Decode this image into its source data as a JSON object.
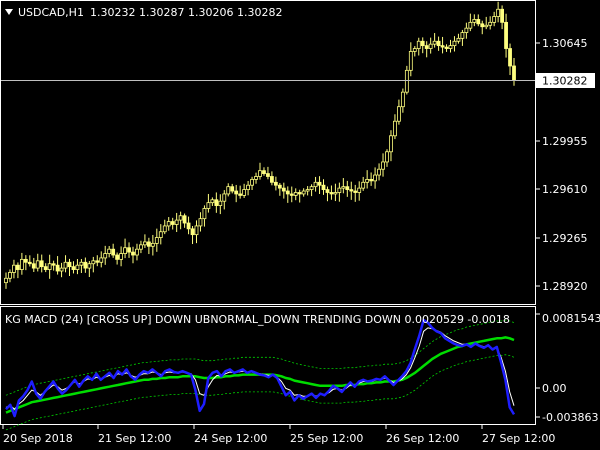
{
  "main_panel": {
    "symbol_label": "USDCAD,H1",
    "ohlc": "1.30232 1.30287 1.30206 1.30282",
    "current_price": "1.30282",
    "price_ticks": [
      "1.30645",
      "1.29955",
      "1.29610",
      "1.29265",
      "1.28920"
    ]
  },
  "indicator_panel": {
    "header": "KG MACD (24)  [CROSS UP]  DOWN  UBNORMAL_DOWN  TRENDING DOWN 0.0020529 -0.0018",
    "ticks": [
      "0.0081543",
      "0.00",
      "-0.003863"
    ]
  },
  "time_axis": {
    "labels": [
      "20 Sep 2018",
      "21 Sep 12:00",
      "24 Sep 12:00",
      "25 Sep 12:00",
      "26 Sep 12:00",
      "27 Sep 12:00"
    ]
  },
  "colors": {
    "background": "#000000",
    "candle": "#ffff80",
    "grid": "#ffffff",
    "price_line": "#c0c0c0",
    "macd_fast": "#1e1eff",
    "macd_signal": "#ffffff",
    "macd_slow": "#00dd00",
    "envelope": "#00cc00"
  },
  "chart_data": [
    {
      "type": "candlestick",
      "title": "USDCAD,H1",
      "ylim": [
        1.2875,
        1.3082
      ],
      "closes": [
        1.2892,
        1.2896,
        1.2901,
        1.2898,
        1.2905,
        1.2903,
        1.2902,
        1.2899,
        1.2904,
        1.29,
        1.2898,
        1.2902,
        1.2901,
        1.2897,
        1.2899,
        1.2903,
        1.29,
        1.2898,
        1.2901,
        1.2903,
        1.2899,
        1.2902,
        1.2904,
        1.2903,
        1.2906,
        1.2909,
        1.2912,
        1.2908,
        1.2905,
        1.2909,
        1.2913,
        1.291,
        1.2908,
        1.2912,
        1.2915,
        1.2917,
        1.2914,
        1.2916,
        1.292,
        1.2924,
        1.2928,
        1.2931,
        1.2929,
        1.2932,
        1.2935,
        1.293,
        1.2926,
        1.2922,
        1.2928,
        1.2933,
        1.294,
        1.2944,
        1.2946,
        1.2942,
        1.2945,
        1.295,
        1.2955,
        1.2952,
        1.295,
        1.2949,
        1.2953,
        1.2956,
        1.296,
        1.2962,
        1.2966,
        1.2964,
        1.2962,
        1.2958,
        1.2956,
        1.2954,
        1.2952,
        1.295,
        1.2949,
        1.2951,
        1.295,
        1.2952,
        1.2953,
        1.2955,
        1.2958,
        1.2956,
        1.2953,
        1.2951,
        1.295,
        1.2951,
        1.2954,
        1.2955,
        1.2953,
        1.2952,
        1.2951,
        1.2954,
        1.2958,
        1.296,
        1.2959,
        1.2963,
        1.2967,
        1.2972,
        1.2979,
        1.299,
        1.3,
        1.301,
        1.302,
        1.3035,
        1.3048,
        1.305,
        1.3055,
        1.3052,
        1.305,
        1.3053,
        1.3055,
        1.3052,
        1.3051,
        1.305,
        1.3052,
        1.3055,
        1.3057,
        1.3061,
        1.3064,
        1.3068,
        1.307,
        1.3067,
        1.3065,
        1.3066,
        1.3068,
        1.3072,
        1.3077,
        1.3068,
        1.305,
        1.3038,
        1.3028
      ]
    },
    {
      "type": "line",
      "title": "KG MACD (24)",
      "ylim": [
        -0.0046,
        0.0087
      ],
      "series": [
        {
          "name": "",
          "color": "#1e1eff",
          "values": [
            -0.003,
            -0.0025,
            -0.0038,
            -0.002,
            -0.0015,
            -0.0008,
            0.0002,
            -0.0012,
            -0.0018,
            -0.001,
            -0.0004,
            0.0002,
            -0.0006,
            -0.0012,
            -0.0008,
            -0.0002,
            0.0004,
            -0.0004,
            0.0003,
            0.0008,
            0.0004,
            0.0011,
            0.0004,
            0.0008,
            0.0012,
            0.0006,
            0.0014,
            0.001,
            0.0016,
            0.0008,
            0.0004,
            0.001,
            0.0014,
            0.0012,
            0.0016,
            0.0012,
            0.0008,
            0.0014,
            0.0016,
            0.0013,
            0.0012,
            0.0014,
            0.0012,
            0.001,
            -0.0008,
            -0.0032,
            -0.0024,
            0.0006,
            0.0012,
            0.0014,
            0.0008,
            0.0014,
            0.0016,
            0.0012,
            0.0014,
            0.0016,
            0.0012,
            0.0014,
            0.0012,
            0.001,
            0.0009,
            0.0007,
            0.001,
            0.0006,
            -0.0004,
            -0.0014,
            -0.001,
            -0.002,
            -0.0014,
            -0.0018,
            -0.0015,
            -0.0012,
            -0.0017,
            -0.0012,
            -0.0014,
            -0.0009,
            -0.0003,
            -0.0006,
            -0.001,
            -0.0004,
            0.0001,
            -0.0004,
            0.0002,
            0.0004,
            0.0002,
            0.0003,
            0.0005,
            0.0004,
            0.0008,
            0.0003,
            -0.0002,
            0.0003,
            0.0008,
            0.0014,
            0.0024,
            0.004,
            0.0055,
            0.0073,
            0.007,
            0.0064,
            0.006,
            0.0058,
            0.0052,
            0.0049,
            0.0046,
            0.0044,
            0.0043,
            0.0045,
            0.0042,
            0.0046,
            0.0043,
            0.0041,
            0.0044,
            0.0039,
            0.0042,
            0.0024,
            0.0004,
            -0.0028,
            -0.0036
          ]
        },
        {
          "name": "",
          "color": "#ffffff",
          "values": [
            -0.0028,
            -0.0026,
            -0.003,
            -0.0024,
            -0.002,
            -0.0014,
            -0.0008,
            -0.001,
            -0.0014,
            -0.001,
            -0.0006,
            -0.0002,
            -0.0004,
            -0.0008,
            -0.0006,
            -0.0002,
            0.0002,
            -0.0001,
            0.0002,
            0.0005,
            0.0004,
            0.0007,
            0.0005,
            0.0007,
            0.0009,
            0.0007,
            0.0011,
            0.001,
            0.0012,
            0.0009,
            0.0007,
            0.0009,
            0.0011,
            0.0011,
            0.0013,
            0.0012,
            0.001,
            0.0012,
            0.0013,
            0.0012,
            0.0012,
            0.0013,
            0.0012,
            0.0011,
            0.0004,
            -0.0012,
            -0.0014,
            -0.0004,
            0.0004,
            0.0009,
            0.0008,
            0.0011,
            0.0013,
            0.0012,
            0.0013,
            0.0014,
            0.0013,
            0.0013,
            0.0012,
            0.0011,
            0.001,
            0.0009,
            0.0009,
            0.0007,
            0.0002,
            -0.0006,
            -0.0008,
            -0.0014,
            -0.0013,
            -0.0015,
            -0.0015,
            -0.0013,
            -0.0015,
            -0.0013,
            -0.0013,
            -0.0011,
            -0.0007,
            -0.0006,
            -0.0008,
            -0.0006,
            -0.0002,
            -0.0003,
            0.0,
            0.0002,
            0.0002,
            0.0002,
            0.0004,
            0.0004,
            0.0006,
            0.0004,
            0.0001,
            0.0002,
            0.0005,
            0.001,
            0.0018,
            0.003,
            0.0043,
            0.006,
            0.0064,
            0.0063,
            0.0061,
            0.0059,
            0.0055,
            0.0052,
            0.0049,
            0.0047,
            0.0045,
            0.0045,
            0.0043,
            0.0045,
            0.0044,
            0.0042,
            0.0043,
            0.004,
            0.0041,
            0.003,
            0.0014,
            -0.001,
            -0.0026
          ]
        },
        {
          "name": "",
          "color": "#00dd00",
          "values": [
            -0.0034,
            -0.0032,
            -0.003,
            -0.0028,
            -0.0026,
            -0.0024,
            -0.0022,
            -0.0021,
            -0.002,
            -0.0019,
            -0.0018,
            -0.0017,
            -0.0016,
            -0.0015,
            -0.0014,
            -0.0013,
            -0.0012,
            -0.0011,
            -0.001,
            -0.0009,
            -0.0008,
            -0.0007,
            -0.0006,
            -0.0005,
            -0.0004,
            -0.0003,
            -0.0002,
            -0.0001,
            0.0,
            0.0001,
            0.0002,
            0.0003,
            0.0004,
            0.0004,
            0.0005,
            0.0005,
            0.0006,
            0.0006,
            0.0007,
            0.0007,
            0.0007,
            0.0008,
            0.0008,
            0.0008,
            0.0008,
            0.0007,
            0.0006,
            0.0006,
            0.0006,
            0.0007,
            0.0007,
            0.0008,
            0.0008,
            0.0009,
            0.0009,
            0.001,
            0.001,
            0.001,
            0.001,
            0.001,
            0.001,
            0.001,
            0.001,
            0.0009,
            0.0008,
            0.0006,
            0.0005,
            0.0003,
            0.0002,
            0.0001,
            0.0,
            -0.0001,
            -0.0002,
            -0.0003,
            -0.0003,
            -0.0003,
            -0.0003,
            -0.0003,
            -0.0003,
            -0.0002,
            -0.0002,
            -0.0002,
            -0.0001,
            -0.0001,
            0.0,
            0.0,
            0.0001,
            0.0001,
            0.0002,
            0.0002,
            0.0002,
            0.0003,
            0.0004,
            0.0006,
            0.0009,
            0.0012,
            0.0016,
            0.002,
            0.0024,
            0.0028,
            0.0031,
            0.0034,
            0.0036,
            0.0038,
            0.004,
            0.0042,
            0.0043,
            0.0045,
            0.0046,
            0.0047,
            0.0048,
            0.0049,
            0.005,
            0.0051,
            0.0052,
            0.0052,
            0.0053,
            0.0052,
            0.005
          ]
        }
      ],
      "envelope_width": 0.002
    }
  ]
}
